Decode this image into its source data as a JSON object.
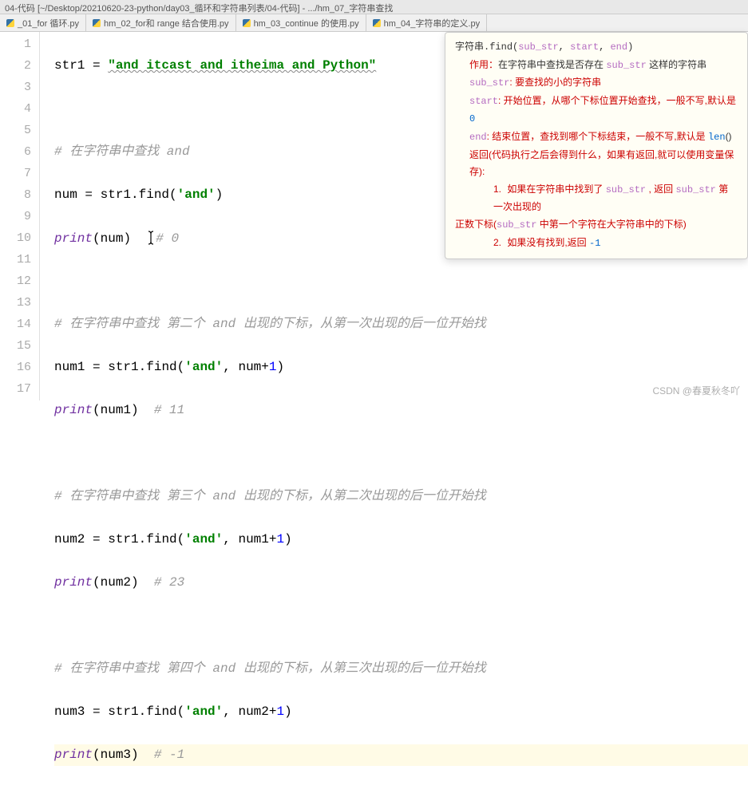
{
  "window": {
    "title": "04-代码 [~/Desktop/20210620-23-python/day03_循环和字符串列表/04-代码] - .../hm_07_字符串查找"
  },
  "tabs": [
    {
      "label": "_01_for 循环.py"
    },
    {
      "label": "hm_02_for和 range 结合使用.py"
    },
    {
      "label": "hm_03_continue 的使用.py"
    },
    {
      "label": "hm_04_字符串的定义.py"
    }
  ],
  "lines": [
    "1",
    "2",
    "3",
    "4",
    "5",
    "6",
    "7",
    "8",
    "9",
    "10",
    "11",
    "12",
    "13",
    "14",
    "15",
    "16",
    "17"
  ],
  "code": {
    "l1": {
      "v1": "str1 ",
      "eq": "= ",
      "s": "\"and itcast and itheima and Python\""
    },
    "l3": {
      "c": "# 在字符串中查找 and"
    },
    "l4": {
      "v1": "num ",
      "eq": "= ",
      "v2": "str1",
      "dot": ".",
      "fn": "find",
      "p1": "(",
      "s": "'and'",
      "p2": ")"
    },
    "l5": {
      "pr": "print",
      "p1": "(",
      "v": "num",
      "p2": ")  ",
      "c": "# 0"
    },
    "l7": {
      "c": "# 在字符串中查找 第二个 and 出现的下标，从第一次出现的后一位开始找"
    },
    "l8": {
      "v1": "num1 ",
      "eq": "= ",
      "v2": "str1",
      "dot": ".",
      "fn": "find",
      "p1": "(",
      "s": "'and'",
      "comma": ", ",
      "v3": "num",
      "plus": "+",
      "n": "1",
      "p2": ")"
    },
    "l9": {
      "pr": "print",
      "p1": "(",
      "v": "num1",
      "p2": ")  ",
      "c": "# 11"
    },
    "l11": {
      "c": "# 在字符串中查找 第三个 and 出现的下标，从第二次出现的后一位开始找"
    },
    "l12": {
      "v1": "num2 ",
      "eq": "= ",
      "v2": "str1",
      "dot": ".",
      "fn": "find",
      "p1": "(",
      "s": "'and'",
      "comma": ", ",
      "v3": "num1",
      "plus": "+",
      "n": "1",
      "p2": ")"
    },
    "l13": {
      "pr": "print",
      "p1": "(",
      "v": "num2",
      "p2": ")  ",
      "c": "# 23"
    },
    "l15": {
      "c": "# 在字符串中查找 第四个 and 出现的下标，从第三次出现的后一位开始找"
    },
    "l16": {
      "v1": "num3 ",
      "eq": "= ",
      "v2": "str1",
      "dot": ".",
      "fn": "find",
      "p1": "(",
      "s": "'and'",
      "comma": ", ",
      "v3": "num2",
      "plus": "+",
      "n": "1",
      "p2": ")"
    },
    "l17": {
      "pr": "print",
      "p1": "(",
      "v": "num3",
      "p2": ")  ",
      "c": "# -1"
    }
  },
  "hint": {
    "sig": {
      "a": "字符串",
      "b": ".find(",
      "c": "sub_str",
      "d": ", ",
      "e": "start",
      "f": ", ",
      "g": "end",
      "h": ")"
    },
    "l2a": "作用：",
    "l2b": "在字符串中查找是否存在 ",
    "l2c": "sub_str",
    "l2d": " 这样的字符串",
    "l3a": "sub_str",
    "l3b": ": 要查找的小的字符串",
    "l4a": "start",
    "l4b": ": 开始位置，从哪个下标位置开始查找，一般不写,默认是 ",
    "l4c": "0",
    "l5a": "end",
    "l5b": ": 结束位置，查找到哪个下标结束，一般不写,默认是 ",
    "l5c": "len",
    "l5d": "()",
    "l6": "返回(代码执行之后会得到什么，如果有返回,就可以使用变量保存):",
    "l7a": "1.",
    "l7b": " 如果在字符串中找到了 ",
    "l7c": "sub_str",
    "l7d": " , 返回 ",
    "l7e": "sub_str",
    "l7f": " 第一次出现的",
    "l8a": "正数下标(",
    "l8b": "sub_str",
    "l8c": " 中第一个字符在大字符串中的下标)",
    "l9a": "2.",
    "l9b": " 如果没有找到,返回 ",
    "l9c": "-1"
  },
  "watermark": "CSDN @春夏秋冬吖"
}
